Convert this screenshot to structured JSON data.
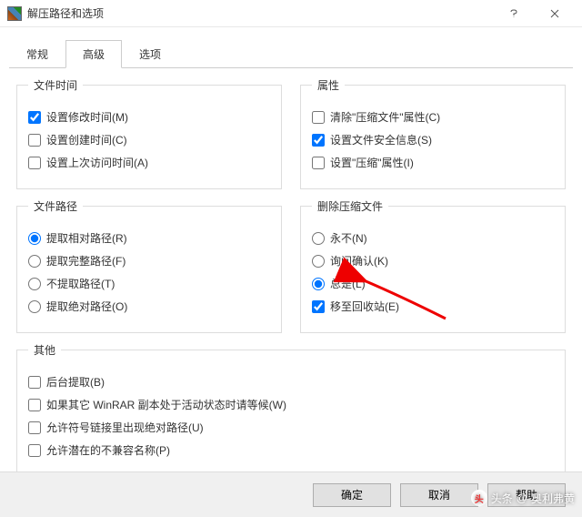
{
  "window": {
    "title": "解压路径和选项"
  },
  "tabs": {
    "general": "常规",
    "advanced": "高级",
    "options": "选项"
  },
  "group_filetime": {
    "legend": "文件时间",
    "items": [
      {
        "label": "设置修改时间(M)",
        "checked": true
      },
      {
        "label": "设置创建时间(C)",
        "checked": false
      },
      {
        "label": "设置上次访问时间(A)",
        "checked": false
      }
    ]
  },
  "group_attr": {
    "legend": "属性",
    "items": [
      {
        "label": "清除\"压缩文件\"属性(C)",
        "checked": false
      },
      {
        "label": "设置文件安全信息(S)",
        "checked": true
      },
      {
        "label": "设置\"压缩\"属性(I)",
        "checked": false
      }
    ]
  },
  "group_path": {
    "legend": "文件路径",
    "items": [
      {
        "label": "提取相对路径(R)"
      },
      {
        "label": "提取完整路径(F)"
      },
      {
        "label": "不提取路径(T)"
      },
      {
        "label": "提取绝对路径(O)"
      }
    ],
    "selected": 0
  },
  "group_delete": {
    "legend": "删除压缩文件",
    "radios": [
      {
        "label": "永不(N)"
      },
      {
        "label": "询问确认(K)"
      },
      {
        "label": "总是(L)"
      }
    ],
    "selected": 2,
    "checkbox": {
      "label": "移至回收站(E)",
      "checked": true
    }
  },
  "group_other": {
    "legend": "其他",
    "items": [
      {
        "label": "后台提取(B)",
        "checked": false
      },
      {
        "label": "如果其它 WinRAR 副本处于活动状态时请等候(W)",
        "checked": false
      },
      {
        "label": "允许符号链接里出现绝对路径(U)",
        "checked": false
      },
      {
        "label": "允许潜在的不兼容名称(P)",
        "checked": false
      }
    ]
  },
  "buttons": {
    "ok": "确定",
    "cancel": "取消",
    "help": "帮助"
  },
  "watermark": {
    "prefix": "头条",
    "at": "@",
    "user": "奥利弗黄"
  }
}
